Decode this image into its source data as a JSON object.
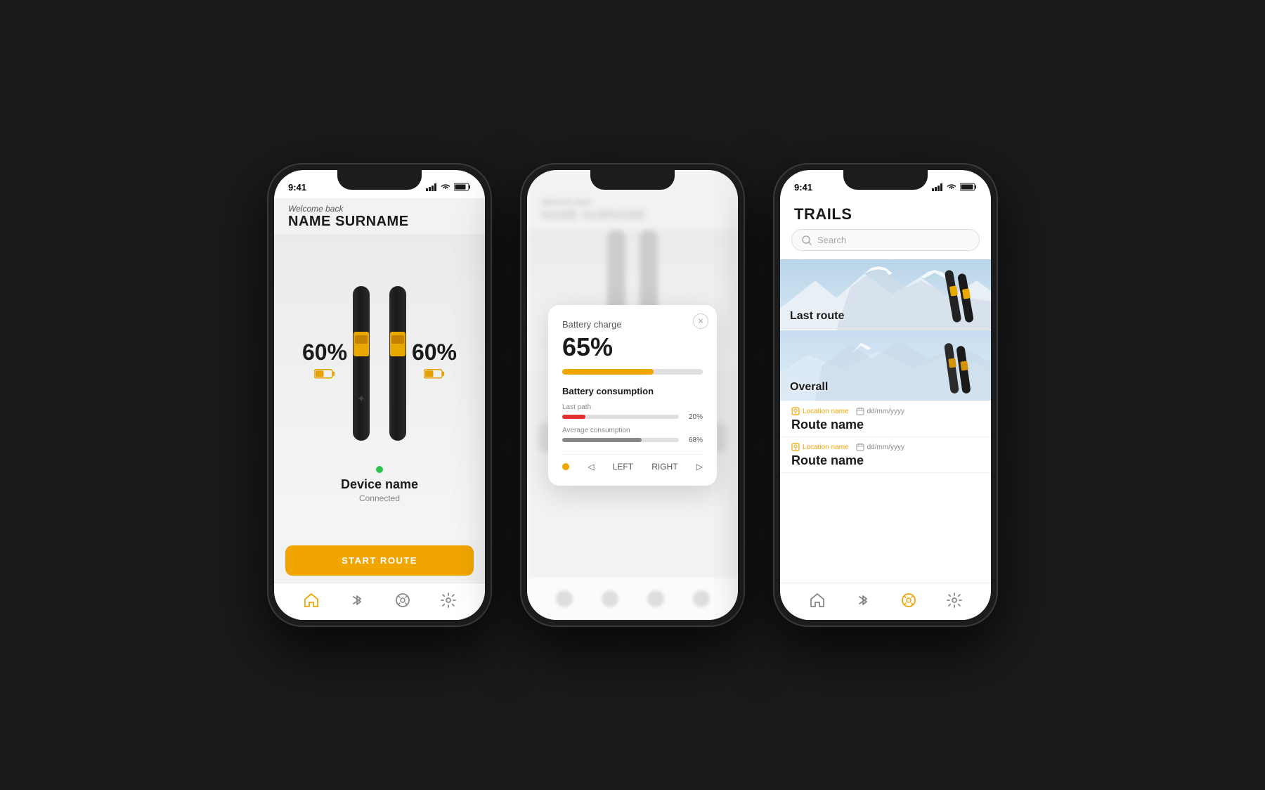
{
  "phone1": {
    "status_time": "9:41",
    "welcome": "Welcome back",
    "user_name": "NAME SURNAME",
    "battery_left": "60%",
    "battery_right": "60%",
    "connected_dot_color": "#2ec44c",
    "device_name": "Device name",
    "connected_label": "Connected",
    "start_route_label": "START ROUTE",
    "nav_items": [
      "home",
      "bluetooth",
      "routes",
      "settings"
    ]
  },
  "phone2": {
    "status_time": "9:41",
    "modal": {
      "battery_charge_label": "Battery charge",
      "battery_pct": "65%",
      "battery_fill_width": "65%",
      "consumption_title": "Battery consumption",
      "last_path_label": "Last path",
      "last_path_pct": "20%",
      "last_path_fill": "20%",
      "avg_label": "Average consumption",
      "avg_pct": "68%",
      "avg_fill": "68%",
      "left_label": "LEFT",
      "right_label": "RIGHT"
    }
  },
  "phone3": {
    "status_time": "9:41",
    "title": "TRAILS",
    "search_placeholder": "Search",
    "cards": [
      {
        "label": "Last route"
      },
      {
        "label": "Overall"
      }
    ],
    "trail_items": [
      {
        "location": "Location name",
        "date": "dd/mm/yyyy",
        "route_name": "Route name"
      },
      {
        "location": "Location name",
        "date": "dd/mm/yyyy",
        "route_name": "Route name"
      }
    ],
    "nav_items": [
      "home",
      "bluetooth",
      "routes",
      "settings"
    ]
  }
}
